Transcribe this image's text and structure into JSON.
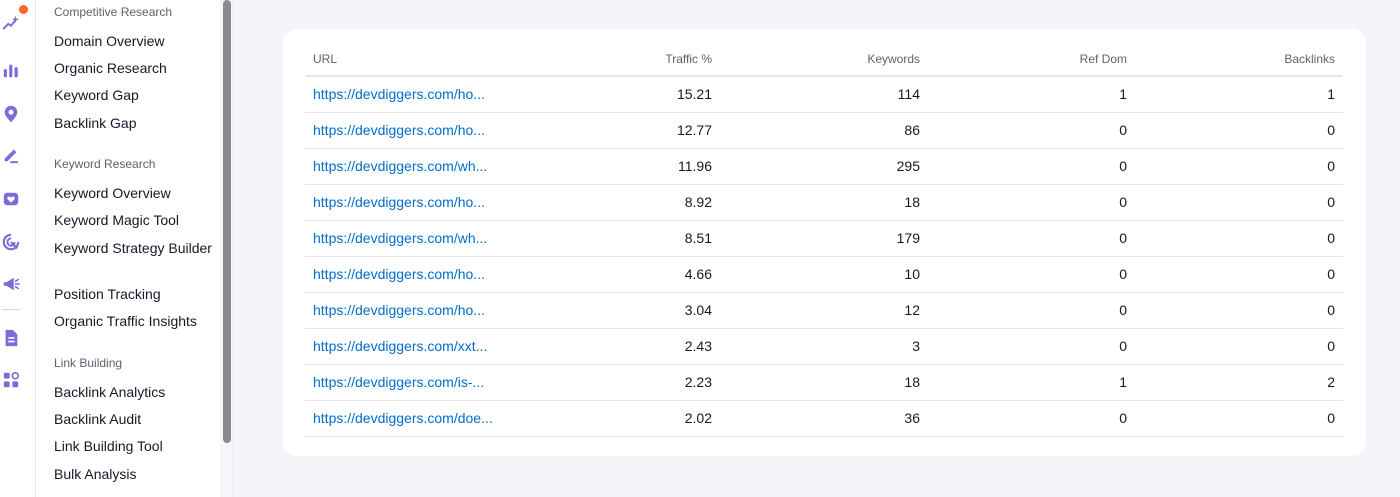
{
  "colors": {
    "accent": "#7b6cd9",
    "notification": "#ff642d",
    "link": "#006dca"
  },
  "rail_icons": [
    "sparkle-icon",
    "bar-chart-icon",
    "location-pin-icon",
    "pen-icon",
    "heart-icon",
    "target-icon",
    "megaphone-icon",
    "document-icon",
    "apps-grid-icon"
  ],
  "sidebar": {
    "sections": [
      {
        "title": "Competitive Research",
        "items": [
          "Domain Overview",
          "Organic Research",
          "Keyword Gap",
          "Backlink Gap"
        ]
      },
      {
        "title": "Keyword Research",
        "items": [
          "Keyword Overview",
          "Keyword Magic Tool",
          "Keyword Strategy Builder",
          "Position Tracking",
          "Organic Traffic Insights"
        ]
      },
      {
        "title": "Link Building",
        "items": [
          "Backlink Analytics",
          "Backlink Audit",
          "Link Building Tool",
          "Bulk Analysis"
        ]
      }
    ]
  },
  "table": {
    "headers": [
      "URL",
      "Traffic %",
      "Keywords",
      "Ref Dom",
      "Backlinks"
    ],
    "rows": [
      [
        "https://devdiggers.com/ho...",
        "15.21",
        "114",
        "1",
        "1"
      ],
      [
        "https://devdiggers.com/ho...",
        "12.77",
        "86",
        "0",
        "0"
      ],
      [
        "https://devdiggers.com/wh...",
        "11.96",
        "295",
        "0",
        "0"
      ],
      [
        "https://devdiggers.com/ho...",
        "8.92",
        "18",
        "0",
        "0"
      ],
      [
        "https://devdiggers.com/wh...",
        "8.51",
        "179",
        "0",
        "0"
      ],
      [
        "https://devdiggers.com/ho...",
        "4.66",
        "10",
        "0",
        "0"
      ],
      [
        "https://devdiggers.com/ho...",
        "3.04",
        "12",
        "0",
        "0"
      ],
      [
        "https://devdiggers.com/xxt...",
        "2.43",
        "3",
        "0",
        "0"
      ],
      [
        "https://devdiggers.com/is-...",
        "2.23",
        "18",
        "1",
        "2"
      ],
      [
        "https://devdiggers.com/doe...",
        "2.02",
        "36",
        "0",
        "0"
      ]
    ]
  }
}
